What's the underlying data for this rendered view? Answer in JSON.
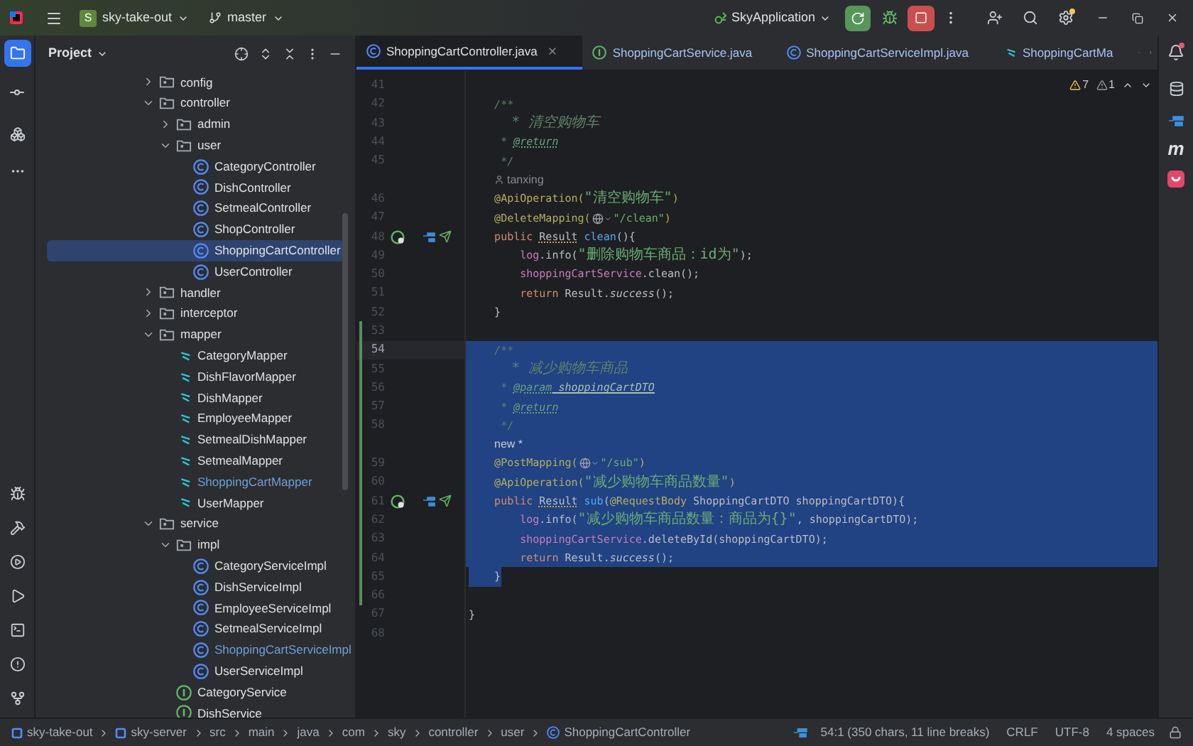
{
  "top_bar": {
    "project_badge": "S",
    "project_name": "sky-take-out",
    "branch": "master",
    "run_config": "SkyApplication"
  },
  "project_panel": {
    "title": "Project",
    "tree": [
      {
        "label": "config",
        "kind": "folder",
        "expanded": false,
        "selected": false
      },
      {
        "label": "controller",
        "kind": "folder",
        "expanded": true,
        "selected": false,
        "children": [
          {
            "label": "admin",
            "kind": "folder",
            "expanded": false,
            "selected": false
          },
          {
            "label": "user",
            "kind": "folder",
            "expanded": true,
            "selected": false,
            "children": [
              {
                "label": "CategoryController",
                "kind": "class",
                "selected": false,
                "new_file": false
              },
              {
                "label": "DishController",
                "kind": "class",
                "selected": false,
                "new_file": false
              },
              {
                "label": "SetmealController",
                "kind": "class",
                "selected": false,
                "new_file": false
              },
              {
                "label": "ShopController",
                "kind": "class",
                "selected": false,
                "new_file": false
              },
              {
                "label": "ShoppingCartController",
                "kind": "class",
                "selected": true,
                "new_file": false
              },
              {
                "label": "UserController",
                "kind": "class",
                "selected": false,
                "new_file": false
              }
            ]
          }
        ]
      },
      {
        "label": "handler",
        "kind": "folder",
        "expanded": false,
        "selected": false
      },
      {
        "label": "interceptor",
        "kind": "folder",
        "expanded": false,
        "selected": false
      },
      {
        "label": "mapper",
        "kind": "folder",
        "expanded": true,
        "selected": false,
        "children": [
          {
            "label": "CategoryMapper",
            "kind": "mapper",
            "selected": false,
            "new_file": false
          },
          {
            "label": "DishFlavorMapper",
            "kind": "mapper",
            "selected": false,
            "new_file": false
          },
          {
            "label": "DishMapper",
            "kind": "mapper",
            "selected": false,
            "new_file": false
          },
          {
            "label": "EmployeeMapper",
            "kind": "mapper",
            "selected": false,
            "new_file": false
          },
          {
            "label": "SetmealDishMapper",
            "kind": "mapper",
            "selected": false,
            "new_file": false
          },
          {
            "label": "SetmealMapper",
            "kind": "mapper",
            "selected": false,
            "new_file": false
          },
          {
            "label": "ShoppingCartMapper",
            "kind": "mapper",
            "selected": false,
            "new_file": true
          },
          {
            "label": "UserMapper",
            "kind": "mapper",
            "selected": false,
            "new_file": false
          }
        ]
      },
      {
        "label": "service",
        "kind": "folder",
        "expanded": true,
        "selected": false,
        "children": [
          {
            "label": "impl",
            "kind": "folder",
            "expanded": true,
            "selected": false,
            "children": [
              {
                "label": "CategoryServiceImpl",
                "kind": "class",
                "selected": false,
                "new_file": false
              },
              {
                "label": "DishServiceImpl",
                "kind": "class",
                "selected": false,
                "new_file": false
              },
              {
                "label": "EmployeeServiceImpl",
                "kind": "class",
                "selected": false,
                "new_file": false
              },
              {
                "label": "SetmealServiceImpl",
                "kind": "class",
                "selected": false,
                "new_file": false
              },
              {
                "label": "ShoppingCartServiceImpl",
                "kind": "class",
                "selected": false,
                "new_file": true
              },
              {
                "label": "UserServiceImpl",
                "kind": "class",
                "selected": false,
                "new_file": false
              }
            ]
          },
          {
            "label": "CategoryService",
            "kind": "interface",
            "selected": false,
            "new_file": false
          },
          {
            "label": "DishService",
            "kind": "interface",
            "selected": false,
            "new_file": false
          }
        ]
      }
    ]
  },
  "tabs": [
    {
      "label": "ShoppingCartController.java",
      "kind": "class",
      "selected": true,
      "closable": true
    },
    {
      "label": "ShoppingCartService.java",
      "kind": "interface",
      "selected": false,
      "closable": false
    },
    {
      "label": "ShoppingCartServiceImpl.java",
      "kind": "class",
      "selected": false,
      "closable": false
    },
    {
      "label": "ShoppingCartMa",
      "kind": "mapper",
      "selected": false,
      "closable": false
    }
  ],
  "inspections": {
    "warnings": "7",
    "weak_warnings": "1"
  },
  "right_toolbar": {
    "mybatis_glyph": "m"
  },
  "code_lines": [
    {
      "kind": "line",
      "number": "41"
    },
    {
      "kind": "line",
      "number": "42",
      "segments": [
        {
          "text": "    /**",
          "kind": "comment"
        }
      ]
    },
    {
      "kind": "line",
      "number": "43",
      "segments": [
        {
          "text": "     * 清空购物车",
          "kind": "comment"
        }
      ]
    },
    {
      "kind": "line",
      "number": "44",
      "segments": [
        {
          "text": "     * ",
          "kind": "comment"
        },
        {
          "text": "@return",
          "kind": "doctag"
        }
      ]
    },
    {
      "kind": "line",
      "number": "45",
      "segments": [
        {
          "text": "     */",
          "kind": "comment"
        }
      ]
    },
    {
      "kind": "author",
      "text": "tanxing"
    },
    {
      "kind": "line",
      "number": "46",
      "segments": [
        {
          "text": "    @ApiOperation(",
          "kind": "annotation"
        },
        {
          "text": "\"清空购物车\"",
          "kind": "string"
        },
        {
          "text": ")",
          "kind": "annotation"
        }
      ]
    },
    {
      "kind": "line",
      "number": "47",
      "segments": [
        {
          "text": "    @DeleteMapping(",
          "kind": "annotation"
        },
        {
          "kind": "url_icon"
        },
        {
          "text": "\"/clean\"",
          "kind": "string"
        },
        {
          "text": ")",
          "kind": "annotation"
        }
      ]
    },
    {
      "kind": "line",
      "number": "48",
      "endpoint": true,
      "segments": [
        {
          "text": "    public ",
          "kind": "keyword"
        },
        {
          "text": "Result",
          "kind": "warn"
        },
        {
          "text": " clean",
          "kind": "method"
        },
        {
          "text": "(){",
          "kind": "plain"
        }
      ]
    },
    {
      "kind": "line",
      "number": "49",
      "segments": [
        {
          "text": "        log",
          "kind": "field"
        },
        {
          "text": ".info(",
          "kind": "plain"
        },
        {
          "text": "\"删除购物车商品：id为\"",
          "kind": "string"
        },
        {
          "text": ");",
          "kind": "plain"
        }
      ]
    },
    {
      "kind": "line",
      "number": "50",
      "segments": [
        {
          "text": "        shoppingCartService",
          "kind": "field"
        },
        {
          "text": ".clean();",
          "kind": "plain"
        }
      ]
    },
    {
      "kind": "line",
      "number": "51",
      "segments": [
        {
          "text": "        return ",
          "kind": "keyword"
        },
        {
          "text": "Result.",
          "kind": "plain"
        },
        {
          "text": "success",
          "kind": "static"
        },
        {
          "text": "();",
          "kind": "plain"
        }
      ]
    },
    {
      "kind": "line",
      "number": "52",
      "segments": [
        {
          "text": "    }",
          "kind": "plain"
        }
      ]
    },
    {
      "kind": "line",
      "number": "53",
      "changed": true
    },
    {
      "kind": "line",
      "number": "54",
      "changed": true,
      "current": true,
      "selected": true,
      "segments": [
        {
          "text": "    /**",
          "kind": "comment"
        }
      ]
    },
    {
      "kind": "line",
      "number": "55",
      "changed": true,
      "selected": true,
      "segments": [
        {
          "text": "     * 减少购物车商品",
          "kind": "comment"
        }
      ]
    },
    {
      "kind": "line",
      "number": "56",
      "changed": true,
      "selected": true,
      "segments": [
        {
          "text": "     * ",
          "kind": "comment"
        },
        {
          "text": "@param",
          "kind": "doctag"
        },
        {
          "text": " shoppingCartDTO",
          "kind": "docparam"
        }
      ]
    },
    {
      "kind": "line",
      "number": "57",
      "changed": true,
      "selected": true,
      "segments": [
        {
          "text": "     * ",
          "kind": "comment"
        },
        {
          "text": "@return",
          "kind": "doctag"
        }
      ]
    },
    {
      "kind": "line",
      "number": "58",
      "changed": true,
      "selected": true,
      "segments": [
        {
          "text": "     */",
          "kind": "comment"
        }
      ]
    },
    {
      "kind": "vcs",
      "text": "new *",
      "changed": true,
      "selected": true
    },
    {
      "kind": "line",
      "number": "59",
      "changed": true,
      "selected": true,
      "segments": [
        {
          "text": "    @PostMapping(",
          "kind": "annotation"
        },
        {
          "kind": "url_icon"
        },
        {
          "text": "\"/sub\"",
          "kind": "string"
        },
        {
          "text": ")",
          "kind": "annotation"
        }
      ]
    },
    {
      "kind": "line",
      "number": "60",
      "changed": true,
      "selected": true,
      "segments": [
        {
          "text": "    @ApiOperation(",
          "kind": "annotation"
        },
        {
          "text": "\"减少购物车商品数量\"",
          "kind": "string"
        },
        {
          "text": ")",
          "kind": "annotation"
        }
      ]
    },
    {
      "kind": "line",
      "number": "61",
      "changed": true,
      "selected": true,
      "endpoint": true,
      "segments": [
        {
          "text": "    public ",
          "kind": "keyword"
        },
        {
          "text": "Result",
          "kind": "warn"
        },
        {
          "text": " sub",
          "kind": "method"
        },
        {
          "text": "(",
          "kind": "plain"
        },
        {
          "text": "@RequestBody",
          "kind": "annotation"
        },
        {
          "text": " ShoppingCartDTO shoppingCartDTO){",
          "kind": "plain"
        }
      ]
    },
    {
      "kind": "line",
      "number": "62",
      "changed": true,
      "selected": true,
      "segments": [
        {
          "text": "        log",
          "kind": "field"
        },
        {
          "text": ".info(",
          "kind": "plain"
        },
        {
          "text": "\"减少购物车商品数量：商品为{}\"",
          "kind": "string"
        },
        {
          "text": ", shoppingCartDTO);",
          "kind": "plain"
        }
      ]
    },
    {
      "kind": "line",
      "number": "63",
      "changed": true,
      "selected": true,
      "segments": [
        {
          "text": "        shoppingCartService",
          "kind": "field"
        },
        {
          "text": ".deleteById(shoppingCartDTO);",
          "kind": "plain"
        }
      ]
    },
    {
      "kind": "line",
      "number": "64",
      "changed": true,
      "selected": true,
      "segments": [
        {
          "text": "        return ",
          "kind": "keyword"
        },
        {
          "text": "Result.",
          "kind": "plain"
        },
        {
          "text": "success",
          "kind": "static"
        },
        {
          "text": "();",
          "kind": "plain"
        }
      ]
    },
    {
      "kind": "line",
      "number": "65",
      "changed": true,
      "selected": true,
      "selection_ends": true,
      "segments": [
        {
          "text": "    }",
          "kind": "plain"
        }
      ]
    },
    {
      "kind": "line",
      "number": "66",
      "changed": true
    },
    {
      "kind": "line",
      "number": "67",
      "segments": [
        {
          "text": "}",
          "kind": "plain"
        }
      ]
    },
    {
      "kind": "line",
      "number": "68"
    }
  ],
  "breadcrumbs": [
    {
      "label": "sky-take-out",
      "kind": "module"
    },
    {
      "label": "sky-server",
      "kind": "module"
    },
    {
      "label": "src",
      "kind": "dir"
    },
    {
      "label": "main",
      "kind": "dir"
    },
    {
      "label": "java",
      "kind": "dir"
    },
    {
      "label": "com",
      "kind": "dir"
    },
    {
      "label": "sky",
      "kind": "dir"
    },
    {
      "label": "controller",
      "kind": "dir"
    },
    {
      "label": "user",
      "kind": "dir"
    },
    {
      "label": "ShoppingCartController",
      "kind": "class"
    }
  ],
  "status_bar": {
    "position": "54:1 (350 chars, 11 line breaks)",
    "line_separator": "CRLF",
    "encoding": "UTF-8",
    "indent": "4 spaces"
  }
}
